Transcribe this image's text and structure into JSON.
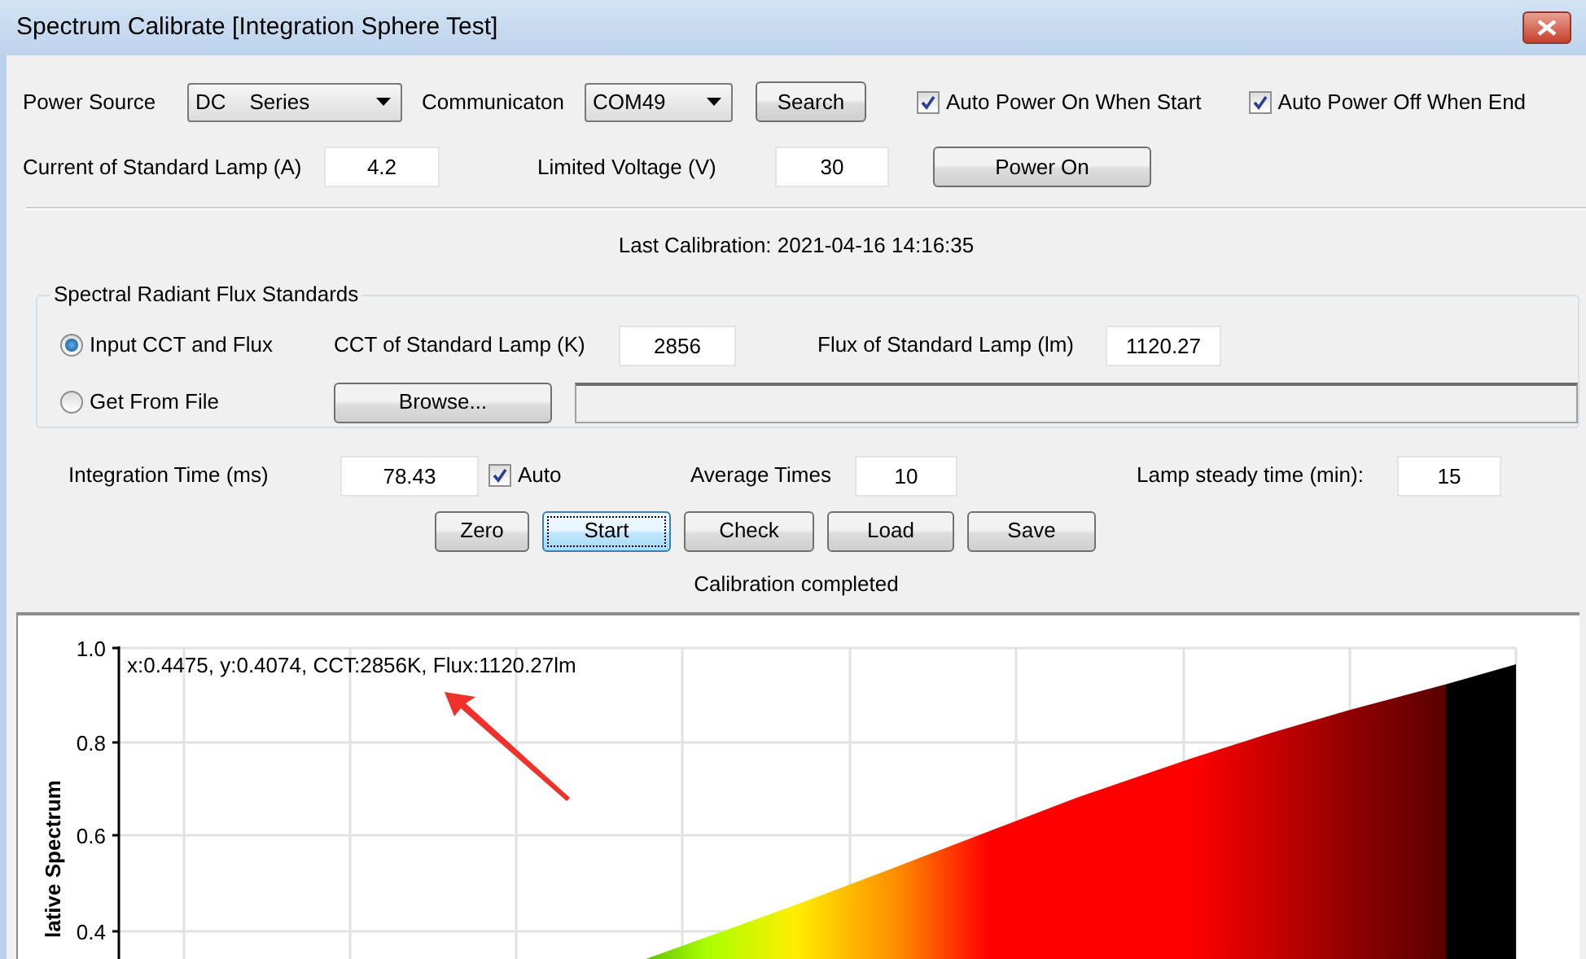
{
  "window": {
    "title": "Spectrum Calibrate [Integration Sphere Test]"
  },
  "power": {
    "source_label": "Power Source",
    "source_value": "DC    Series",
    "comm_label": "Communicaton",
    "comm_value": "COM49",
    "search_button": "Search",
    "auto_on": {
      "label": "Auto Power On When Start",
      "checked": true
    },
    "auto_off": {
      "label": "Auto Power Off When End",
      "checked": true
    },
    "current_label": "Current of Standard Lamp (A)",
    "current_value": "4.2",
    "voltage_label": "Limited Voltage (V)",
    "voltage_value": "30",
    "power_button": "Power On"
  },
  "last_calibration": "Last Calibration: 2021-04-16 14:16:35",
  "standards": {
    "title": "Spectral Radiant Flux Standards",
    "options": [
      {
        "label": "Input CCT and Flux",
        "selected": true
      },
      {
        "label": "Get From File",
        "selected": false
      }
    ],
    "cct_label": "CCT of Standard Lamp (K)",
    "cct_value": "2856",
    "flux_label": "Flux of Standard Lamp (lm)",
    "flux_value": "1120.27",
    "browse_button": "Browse..."
  },
  "measure": {
    "integration_label": "Integration Time (ms)",
    "integration_value": "78.43",
    "auto": {
      "label": "Auto",
      "checked": true
    },
    "average_label": "Average Times",
    "average_value": "10",
    "steady_label": "Lamp steady time (min):",
    "steady_value": "15"
  },
  "buttons": [
    {
      "label": "Zero",
      "focused": false
    },
    {
      "label": "Start",
      "focused": true
    },
    {
      "label": "Check",
      "focused": false
    },
    {
      "label": "Load",
      "focused": false
    },
    {
      "label": "Save",
      "focused": false
    }
  ],
  "status": "Calibration completed",
  "chart": {
    "ylabel": "lative Spectrum",
    "y_tick_labels": [
      "1.0",
      "0.8",
      "0.6",
      "0.4"
    ],
    "annotation": "x:0.4475, y:0.4074, CCT:2856K, Flux:1120.27lm"
  }
}
